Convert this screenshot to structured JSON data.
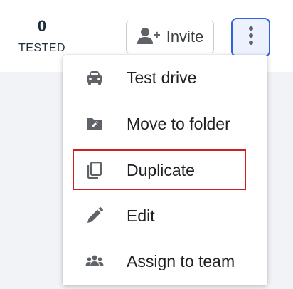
{
  "stats": {
    "tested_value": "0",
    "tested_label": "TESTED"
  },
  "toolbar": {
    "invite_label": "Invite"
  },
  "menu": {
    "items": [
      {
        "label": "Test drive",
        "icon": "car-icon"
      },
      {
        "label": "Move to folder",
        "icon": "folder-move-icon"
      },
      {
        "label": "Duplicate",
        "icon": "copy-icon"
      },
      {
        "label": "Edit",
        "icon": "pencil-icon"
      },
      {
        "label": "Assign to team",
        "icon": "team-icon"
      }
    ],
    "highlighted_item": "Duplicate"
  },
  "colors": {
    "accent": "#2f63d8",
    "highlight": "#d11f1f",
    "icon": "#5f6368",
    "text": "#202124"
  }
}
